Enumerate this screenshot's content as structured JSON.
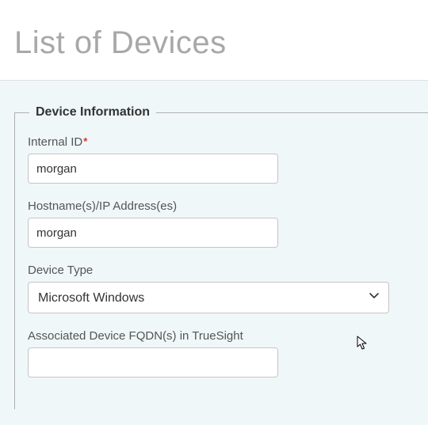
{
  "page": {
    "title": "List of Devices"
  },
  "fieldset": {
    "legend": "Device Information"
  },
  "fields": {
    "internalId": {
      "label": "Internal ID",
      "required": true,
      "value": "morgan"
    },
    "hostnames": {
      "label": "Hostname(s)/IP Address(es)",
      "value": "morgan"
    },
    "deviceType": {
      "label": "Device Type",
      "selected": "Microsoft Windows"
    },
    "fqdn": {
      "label": "Associated Device FQDN(s) in TrueSight",
      "value": ""
    }
  }
}
